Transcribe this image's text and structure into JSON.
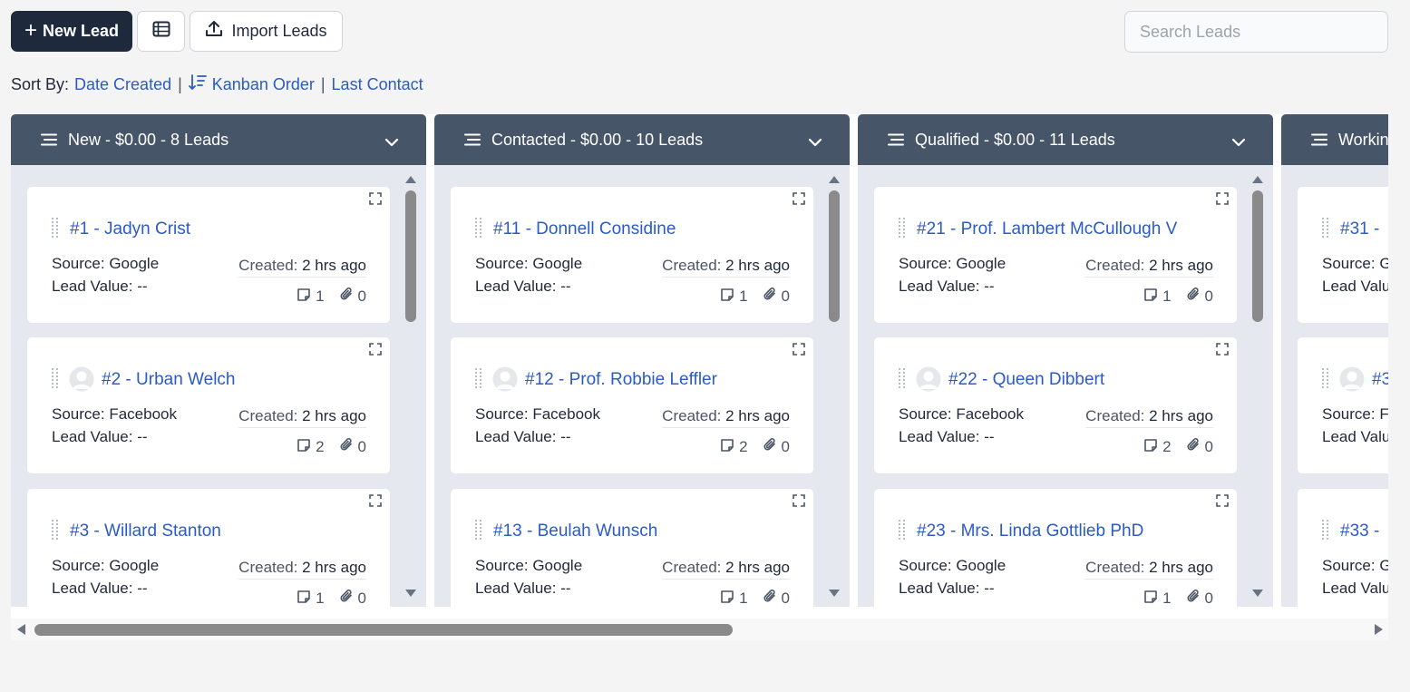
{
  "toolbar": {
    "new_lead_label": "New Lead",
    "import_label": "Import Leads",
    "search_placeholder": "Search Leads"
  },
  "sort": {
    "label": "Sort By:",
    "options": [
      "Date Created",
      "Kanban Order",
      "Last Contact"
    ]
  },
  "labels": {
    "source": "Source:",
    "lead_value": "Lead Value:",
    "created": "Created:"
  },
  "colors": {
    "header_bg": "#475569",
    "primary_button": "#1e293b",
    "link": "#2b5bc4",
    "column_bg": "#e5e9ef"
  },
  "columns": [
    {
      "title": "New - $0.00 - 8 Leads",
      "cards": [
        {
          "title": "#1 - Jadyn Crist",
          "avatar": false,
          "source": "Google",
          "value": "--",
          "created": "2 hrs ago",
          "notes": "1",
          "attachments": "0"
        },
        {
          "title": "#2 - Urban Welch",
          "avatar": true,
          "source": "Facebook",
          "value": "--",
          "created": "2 hrs ago",
          "notes": "2",
          "attachments": "0"
        },
        {
          "title": "#3 - Willard Stanton",
          "avatar": false,
          "source": "Google",
          "value": "--",
          "created": "2 hrs ago",
          "notes": "1",
          "attachments": "0"
        }
      ]
    },
    {
      "title": "Contacted - $0.00 - 10 Leads",
      "cards": [
        {
          "title": "#11 - Donnell Considine",
          "avatar": false,
          "source": "Google",
          "value": "--",
          "created": "2 hrs ago",
          "notes": "1",
          "attachments": "0"
        },
        {
          "title": "#12 - Prof. Robbie Leffler",
          "avatar": true,
          "source": "Facebook",
          "value": "--",
          "created": "2 hrs ago",
          "notes": "2",
          "attachments": "0"
        },
        {
          "title": "#13 - Beulah Wunsch",
          "avatar": false,
          "source": "Google",
          "value": "--",
          "created": "2 hrs ago",
          "notes": "1",
          "attachments": "0"
        }
      ]
    },
    {
      "title": "Qualified - $0.00 - 11 Leads",
      "cards": [
        {
          "title": "#21 - Prof. Lambert McCullough V",
          "avatar": false,
          "source": "Google",
          "value": "--",
          "created": "2 hrs ago",
          "notes": "1",
          "attachments": "0"
        },
        {
          "title": "#22 - Queen Dibbert",
          "avatar": true,
          "source": "Facebook",
          "value": "--",
          "created": "2 hrs ago",
          "notes": "2",
          "attachments": "0"
        },
        {
          "title": "#23 - Mrs. Linda Gottlieb PhD",
          "avatar": false,
          "source": "Google",
          "value": "--",
          "created": "2 hrs ago",
          "notes": "1",
          "attachments": "0"
        }
      ]
    },
    {
      "title": "Working",
      "cards": [
        {
          "title": "#31 - ",
          "avatar": false,
          "source": "Google",
          "value": "--",
          "created": "",
          "notes": "",
          "attachments": ""
        },
        {
          "title": "#3",
          "avatar": true,
          "source": "Facebook",
          "value": "--",
          "created": "",
          "notes": "",
          "attachments": ""
        },
        {
          "title": "#33 - ",
          "avatar": false,
          "source": "Google",
          "value": "--",
          "created": "",
          "notes": "",
          "attachments": ""
        }
      ]
    }
  ]
}
